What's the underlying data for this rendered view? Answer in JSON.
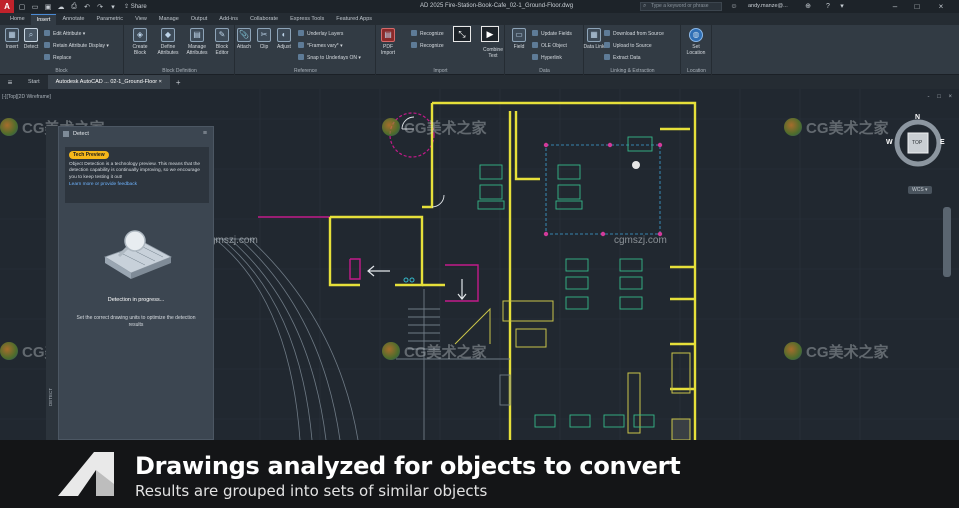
{
  "titlebar": {
    "app_letter": "A",
    "share_label": "Share",
    "doc_title": "AD 2025  Fire-Station-Book-Cafe_02-1_Ground-Floor.dwg",
    "search_placeholder": "Type a keyword or phrase",
    "user": "andy.manze@..."
  },
  "ribbon_tabs": [
    "Home",
    "Insert",
    "Annotate",
    "Parametric",
    "View",
    "Manage",
    "Output",
    "Add-ins",
    "Collaborate",
    "Express Tools",
    "Featured Apps"
  ],
  "ribbon": {
    "block_panel": {
      "title": "Block",
      "insert": "Insert",
      "detect": "Detect",
      "edit_attribute": "Edit Attribute",
      "retain_attribute_display": "Retain Attribute Display",
      "replace": "Replace"
    },
    "block_definition_panel": {
      "title": "Block Definition",
      "create_block": "Create Block",
      "define_attributes": "Define Attributes",
      "manage_attributes": "Manage Attributes",
      "block_editor": "Block Editor"
    },
    "reference_panel": {
      "title": "Reference",
      "attach": "Attach",
      "clip": "Clip",
      "adjust": "Adjust",
      "underlay_layers": "Underlay Layers",
      "frames_vary": "*Frames vary*",
      "snap_to_underlays": "Snap to Underlays ON"
    },
    "import_panel": {
      "title": "Import",
      "pdf_import": "PDF Import",
      "recognize_1": "Recognize",
      "recognize_2": "Recognize",
      "combine_text": "Combine Text"
    },
    "data_panel": {
      "title": "Data",
      "field": "Field",
      "update_fields": "Update Fields",
      "ole_object": "OLE Object",
      "hyperlink": "Hyperlink"
    },
    "linking_panel": {
      "title": "Linking & Extraction",
      "data_link": "Data Link",
      "download_from_source": "Download from Source",
      "upload_to_source": "Upload to Source",
      "extract_data": "Extract  Data"
    },
    "location_panel": {
      "title": "Location",
      "set_location": "Set Location"
    }
  },
  "doc_tabs": [
    "Start",
    "Autodesk AutoCAD ... 02-1_Ground-Floor"
  ],
  "canvas": {
    "view_label": "[-][Top][2D Wireframe]",
    "viewport_controls": "- □ ×"
  },
  "palette": {
    "title": "Detect",
    "rail_label": "DETECT",
    "badge": "Tech Preview",
    "tech_text": "Object Detection is a technology preview. This means that the detection capability is continually improving, so we encourage you to keep testing it out!",
    "link_text": "Learn more or provide feedback",
    "progress": "Detection in progress...",
    "units_hint": "Set the correct drawing units to optimize the detection results"
  },
  "viewcube": {
    "n": "N",
    "w": "W",
    "e": "E",
    "top": "TOP",
    "wcs": "WCS"
  },
  "watermarks": {
    "brand": "CG美术之家",
    "url": "cgmszj.com"
  },
  "caption": {
    "title": "Drawings analyzed for objects to convert",
    "subtitle": "Results are grouped into sets of similar objects"
  },
  "colors": {
    "walls": "#e6e03a",
    "furniture": "#35b98a",
    "magenta": "#c21a8a",
    "accent_badge": "#f5b71a",
    "link": "#6fb4ff"
  }
}
